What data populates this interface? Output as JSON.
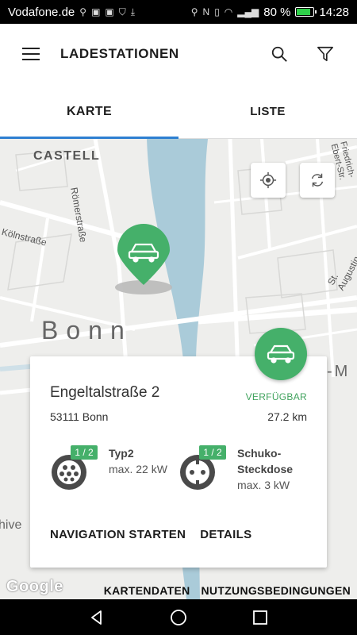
{
  "statusbar": {
    "carrier": "Vodafone.de",
    "battery": "80 %",
    "time": "14:28"
  },
  "appbar": {
    "title": "LADESTATIONEN",
    "menu_icon": "hamburger-menu-icon",
    "search_icon": "search-icon",
    "filter_icon": "filter-icon"
  },
  "tabs": [
    {
      "label": "KARTE",
      "active": true
    },
    {
      "label": "LISTE",
      "active": false
    }
  ],
  "map": {
    "labels": {
      "castell": "CASTELL",
      "roemerstrasse": "Römerstraße",
      "koelnstrasse": "Kölnstraße",
      "bonn": "Bonn",
      "friedrich_ebert": "Friedrich-Ebert-Str.",
      "st_augustin": "St. Augustin",
      "m": "-M",
      "hive": "hive"
    },
    "locate_icon": "crosshair-icon",
    "refresh_icon": "refresh-icon",
    "water_color": "#aacbd9",
    "marker_color": "#45b06a"
  },
  "station": {
    "street": "Engeltalstraße 2",
    "city": "53111 Bonn",
    "status": "VERFÜGBAR",
    "distance": "27.2 km",
    "connectors": [
      {
        "name": "Typ2",
        "power": "max. 22 kW",
        "availability": "1 / 2"
      },
      {
        "name": "Schuko-",
        "name2": "Steckdose",
        "power": "max. 3 kW",
        "availability": "1 / 2"
      }
    ],
    "actions": {
      "navigate": "NAVIGATION STARTEN",
      "details": "DETAILS"
    }
  },
  "attribution": {
    "google": "Google",
    "map_data": "KARTENDATEN",
    "terms": "NUTZUNGSBEDINGUNGEN"
  },
  "navbar": {
    "back_icon": "back-icon",
    "home_icon": "home-icon",
    "recents_icon": "recents-icon"
  }
}
